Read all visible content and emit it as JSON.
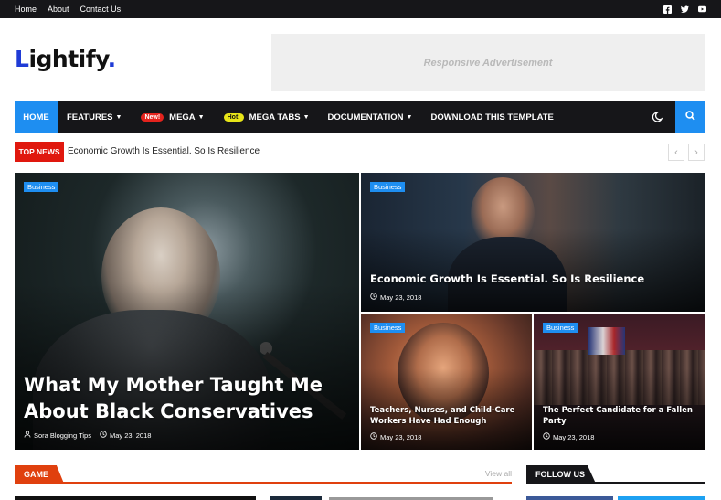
{
  "topbar": {
    "links": [
      "Home",
      "About",
      "Contact Us"
    ],
    "social_icons": [
      "facebook-icon",
      "twitter-icon",
      "youtube-icon"
    ]
  },
  "header": {
    "logo_text": "Lightify",
    "ad_text": "Responsive Advertisement"
  },
  "nav": {
    "home": "HOME",
    "items": [
      {
        "label": "FEATURES",
        "badge": "",
        "dropdown": true
      },
      {
        "label": "MEGA",
        "badge": "New!",
        "badge_color": "#e4231d",
        "dropdown": true
      },
      {
        "label": "MEGA TABS",
        "badge": "Hot!",
        "badge_color": "#e7e518",
        "dropdown": true
      },
      {
        "label": "DOCUMENTATION",
        "badge": "",
        "dropdown": true
      },
      {
        "label": "DOWNLOAD THIS TEMPLATE",
        "badge": "",
        "dropdown": false
      }
    ]
  },
  "ticker": {
    "label": "TOP NEWS",
    "headline": "Economic Growth Is Essential. So Is Resilience"
  },
  "featured": [
    {
      "tag": "Business",
      "title": "What My Mother Taught Me About Black Conservatives",
      "author": "Sora Blogging Tips",
      "date": "May 23, 2018"
    },
    {
      "tag": "Business",
      "title": "Economic Growth Is Essential. So Is Resilience",
      "date": "May 23, 2018"
    },
    {
      "tag": "Business",
      "title": "Teachers, Nurses, and Child-Care Workers Have Had Enough",
      "date": "May 23, 2018"
    },
    {
      "tag": "Business",
      "title": "The Perfect Candidate for a Fallen Party",
      "date": "May 23, 2018"
    }
  ],
  "sections": {
    "game": {
      "label": "GAME",
      "view_all": "View all",
      "accent": "#e0400e"
    },
    "follow": {
      "label": "FOLLOW US"
    }
  },
  "colors": {
    "accent": "#1e8ef1",
    "dark": "#161619",
    "red": "#e0180e"
  }
}
